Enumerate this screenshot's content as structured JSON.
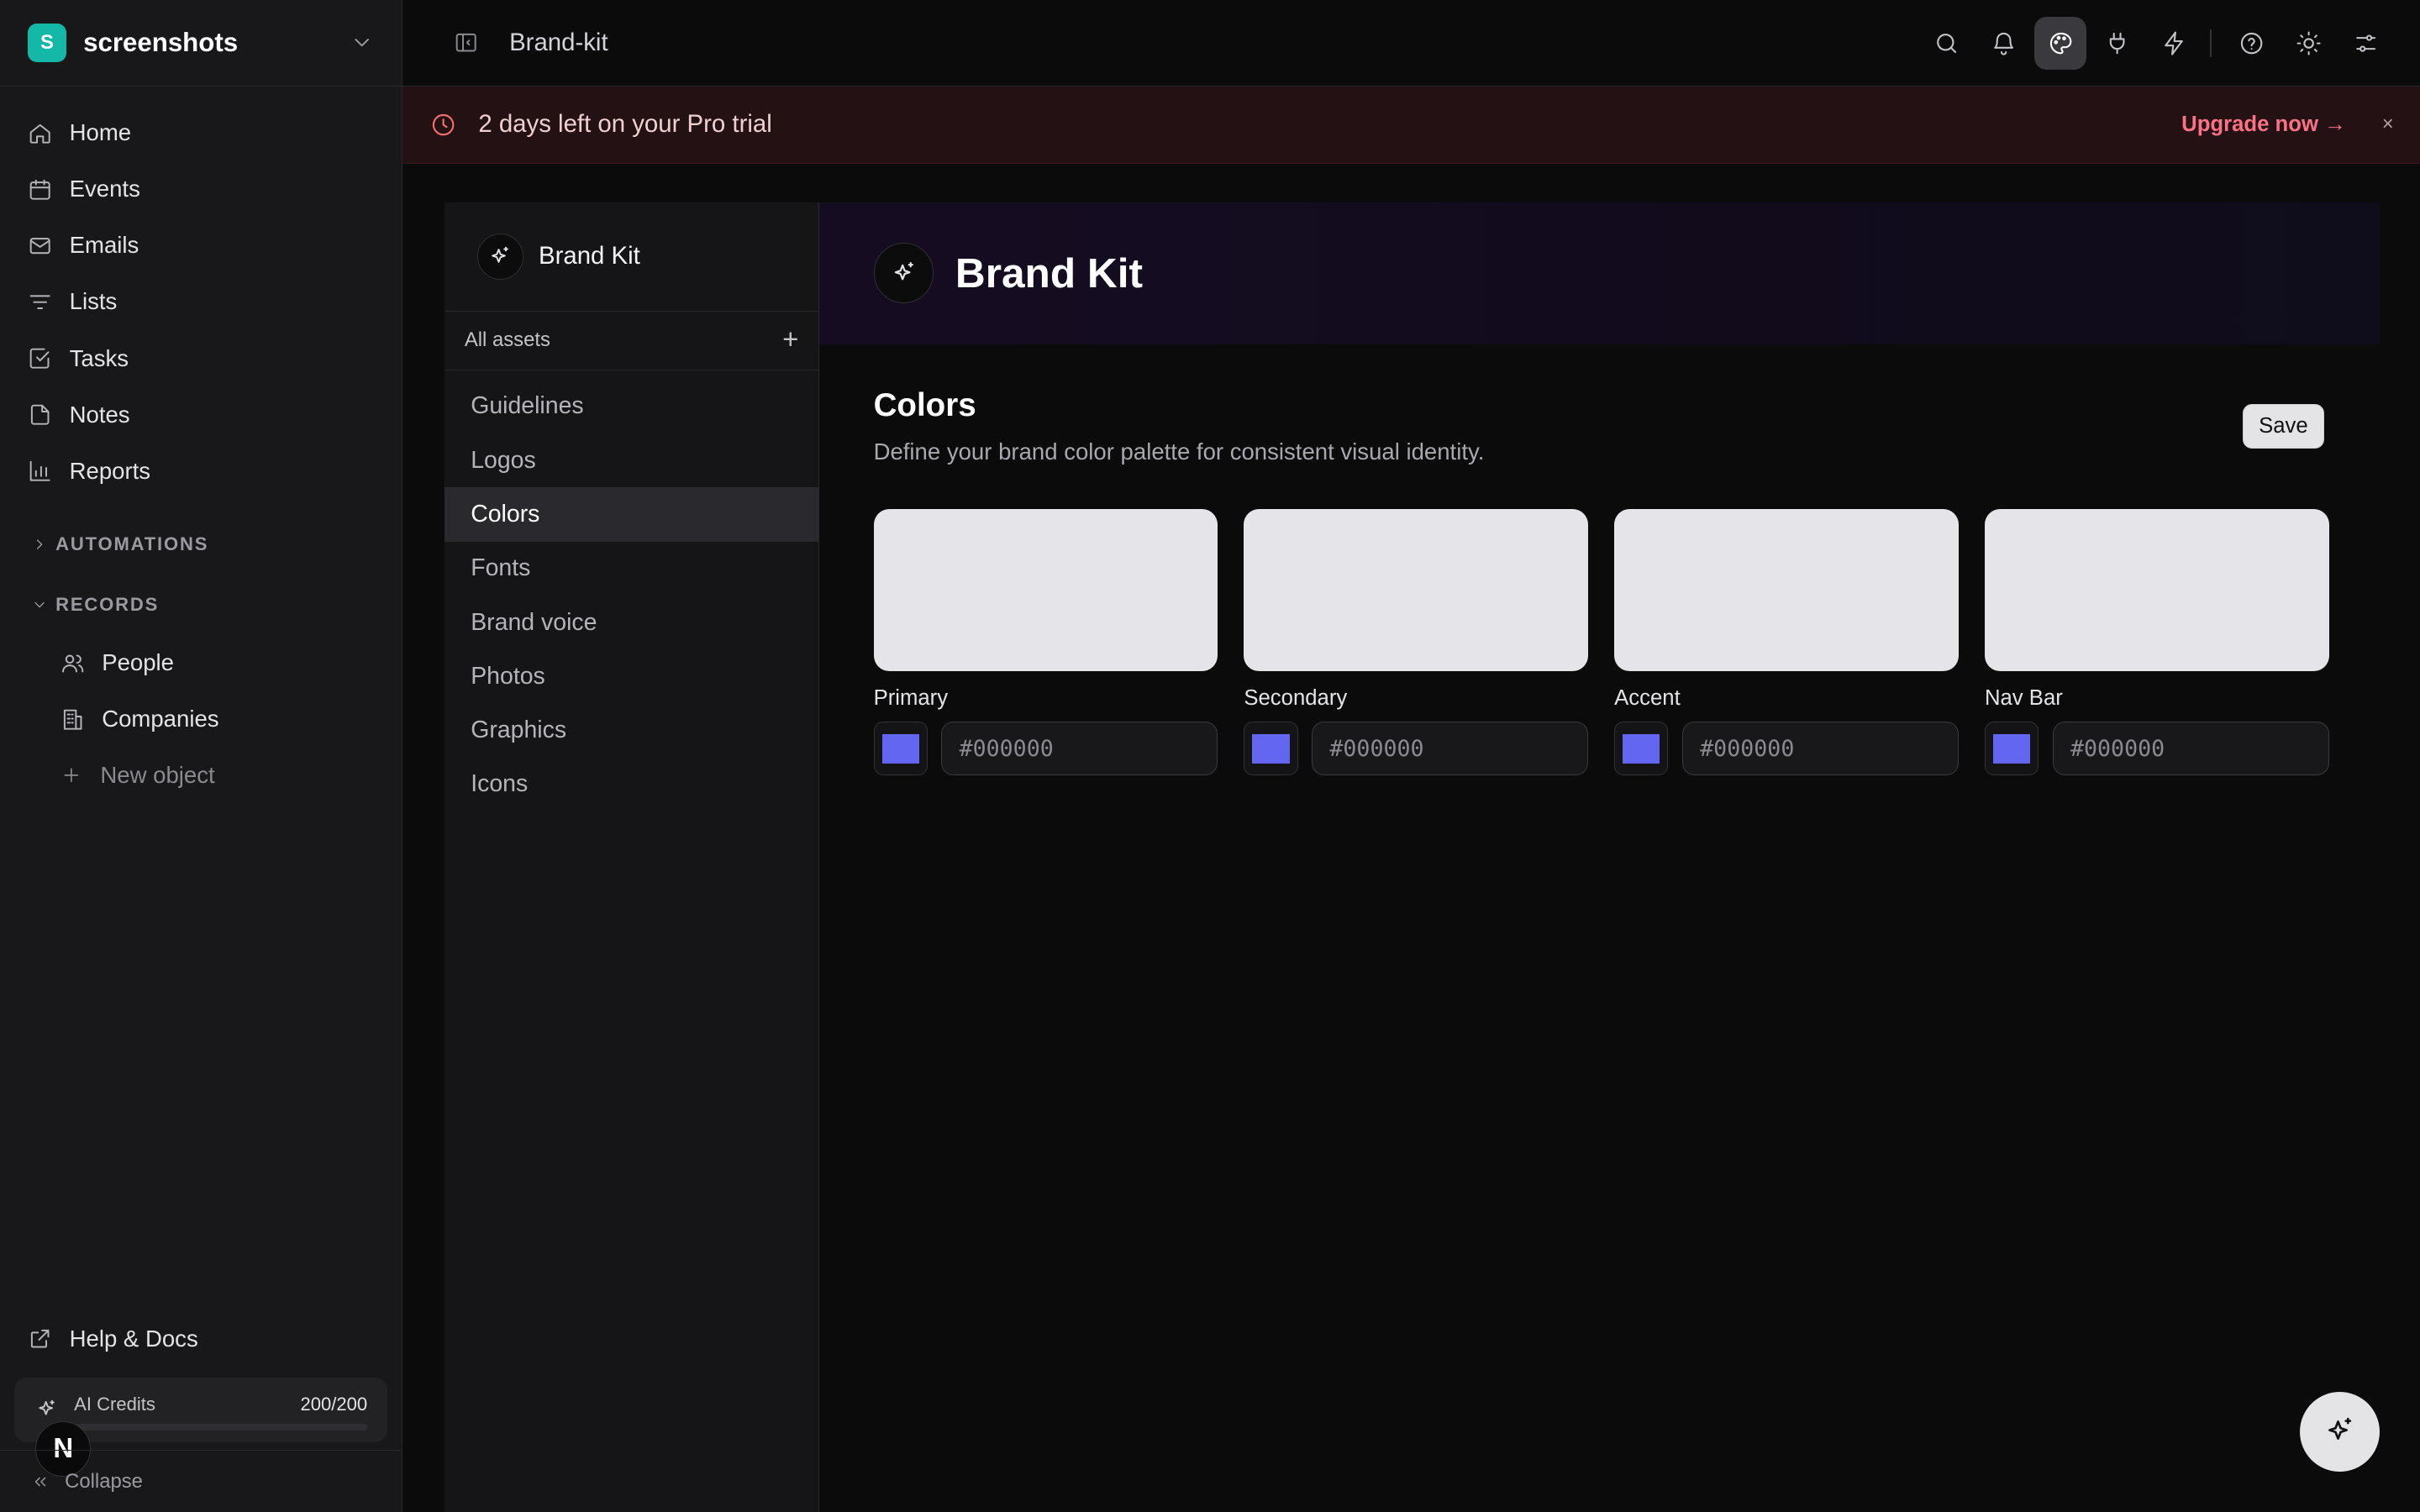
{
  "workspace": {
    "initial": "S",
    "name": "screenshots"
  },
  "nav": [
    {
      "label": "Home",
      "icon": "home-icon"
    },
    {
      "label": "Events",
      "icon": "calendar-icon"
    },
    {
      "label": "Emails",
      "icon": "mail-icon"
    },
    {
      "label": "Lists",
      "icon": "list-filter-icon"
    },
    {
      "label": "Tasks",
      "icon": "check-square-icon"
    },
    {
      "label": "Notes",
      "icon": "file-icon"
    },
    {
      "label": "Reports",
      "icon": "bar-chart-icon"
    }
  ],
  "sections": {
    "automations": "AUTOMATIONS",
    "records": "RECORDS"
  },
  "records": [
    {
      "label": "People",
      "icon": "users-icon"
    },
    {
      "label": "Companies",
      "icon": "building-icon"
    }
  ],
  "new_object": "New object",
  "help": "Help & Docs",
  "credits": {
    "label": "AI Credits",
    "value": "200/200",
    "used_fraction": 0
  },
  "avatar": "N",
  "collapse": "Collapse",
  "topbar": {
    "breadcrumb": "Brand-kit"
  },
  "banner": {
    "text": "2 days left on your Pro trial",
    "upgrade": "Upgrade now →",
    "close": "×"
  },
  "assets_panel": {
    "title": "Brand Kit",
    "all_assets": "All assets",
    "add": "+",
    "items": [
      "Guidelines",
      "Logos",
      "Colors",
      "Fonts",
      "Brand voice",
      "Photos",
      "Graphics",
      "Icons"
    ],
    "active": "Colors"
  },
  "main": {
    "title": "Brand Kit",
    "section_title": "Colors",
    "section_desc": "Define your brand color palette for consistent visual identity.",
    "save": "Save",
    "swatches": [
      {
        "label": "Primary",
        "hex": "#000000",
        "picker_color": "#6366f1"
      },
      {
        "label": "Secondary",
        "hex": "#000000",
        "picker_color": "#6366f1"
      },
      {
        "label": "Accent",
        "hex": "#000000",
        "picker_color": "#6366f1"
      },
      {
        "label": "Nav Bar",
        "hex": "#000000",
        "picker_color": "#6366f1"
      }
    ]
  },
  "colors": {
    "accent": "#14b8a6",
    "picker": "#6366f1",
    "banner_text": "#fb7185"
  }
}
